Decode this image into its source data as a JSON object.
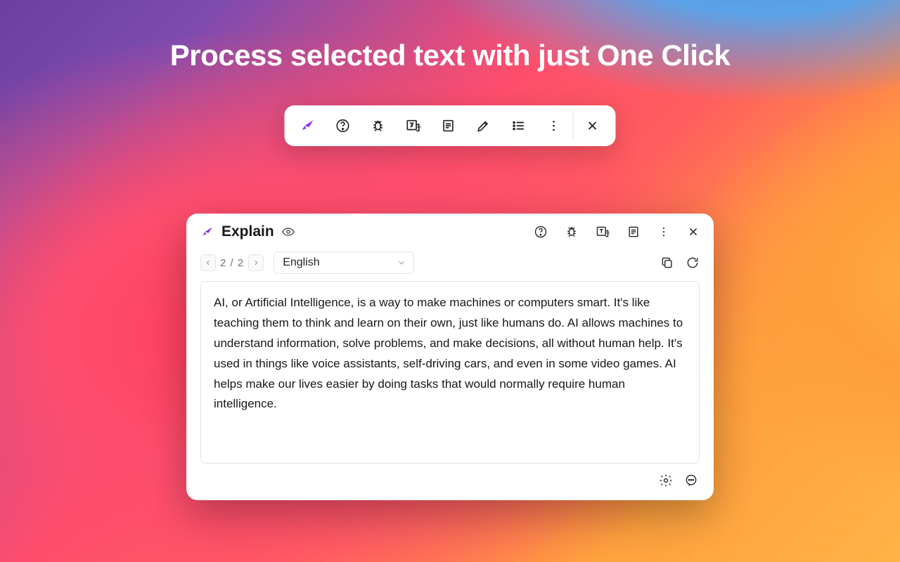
{
  "headline": "Process selected text with just One Click",
  "toolbar": {
    "icons": [
      "logo",
      "help",
      "bug",
      "translate",
      "document",
      "highlight",
      "list",
      "more",
      "close"
    ]
  },
  "panel": {
    "title": "Explain",
    "pager": {
      "current": 2,
      "total": 2,
      "display": "2 / 2"
    },
    "language": "English",
    "content": "AI, or Artificial Intelligence, is a way to make machines or computers smart. It's like teaching them to think and learn on their own, just like humans do. AI allows machines to understand information, solve problems, and make decisions, all without human help. It's used in things like voice assistants, self-driving cars, and even in some video games. AI helps make our lives easier by doing tasks that would normally require human intelligence."
  }
}
